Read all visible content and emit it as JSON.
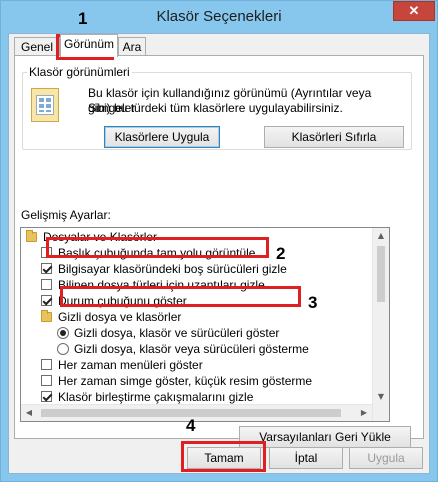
{
  "window": {
    "title": "Klasör Seçenekleri",
    "close_glyph": "✕"
  },
  "tabs": [
    {
      "label": "Genel"
    },
    {
      "label": "Görünüm"
    },
    {
      "label": "Ara"
    }
  ],
  "folder_views": {
    "title": "Klasör görünümleri",
    "description_line1": "Bu klasör için kullandığınız görünümü (Ayrıntılar veya Simgeler",
    "description_line2": "gibi) bu türdeki tüm klasörlere uygulayabilirsiniz.",
    "apply_button": "Klasörlere Uygula",
    "reset_button": "Klasörleri Sıfırla"
  },
  "advanced": {
    "title": "Gelişmiş Ayarlar:",
    "items": [
      {
        "type": "folder",
        "label": "Dosyalar ve Klasörler",
        "indent": 0
      },
      {
        "type": "checkbox",
        "checked": false,
        "label": "Başlık çubuğunda tam yolu görüntüle",
        "indent": 1
      },
      {
        "type": "checkbox",
        "checked": true,
        "label": "Bilgisayar klasöründeki boş sürücüleri gizle",
        "indent": 1
      },
      {
        "type": "checkbox",
        "checked": false,
        "label": "Bilinen dosya türleri için uzantıları gizle",
        "indent": 1
      },
      {
        "type": "checkbox",
        "checked": true,
        "label": "Durum çubuğunu göster",
        "indent": 1
      },
      {
        "type": "folder",
        "label": "Gizli dosya ve klasörler",
        "indent": 1
      },
      {
        "type": "radio",
        "checked": true,
        "label": "Gizli dosya, klasör ve sürücüleri göster",
        "indent": 2
      },
      {
        "type": "radio",
        "checked": false,
        "label": "Gizli dosya, klasör veya sürücüleri gösterme",
        "indent": 2
      },
      {
        "type": "checkbox",
        "checked": false,
        "label": "Her zaman menüleri göster",
        "indent": 1
      },
      {
        "type": "checkbox",
        "checked": false,
        "label": "Her zaman simge göster, küçük resim gösterme",
        "indent": 1
      },
      {
        "type": "checkbox",
        "checked": true,
        "label": "Klasör birleştirme çakışmalarını gizle",
        "indent": 1
      }
    ],
    "restore_button": "Varsayılanları Geri Yükle"
  },
  "buttons": {
    "ok": "Tamam",
    "cancel": "İptal",
    "apply": "Uygula"
  },
  "annotations": {
    "n1": "1",
    "n2": "2",
    "n3": "3",
    "n4": "4"
  },
  "colors": {
    "highlight": "#e02020",
    "frame": "#87c7ee",
    "close": "#c7463c"
  }
}
